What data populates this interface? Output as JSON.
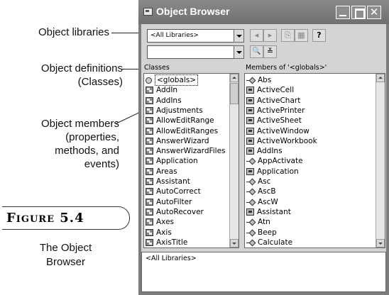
{
  "callouts": {
    "libraries": "Object libraries",
    "definitions_line1": "Object definitions",
    "definitions_line2": "(Classes)",
    "members_line1": "Object members",
    "members_line2": "(properties,",
    "members_line3": "methods, and",
    "members_line4": "events)"
  },
  "figure": {
    "label": "Figure 5.4",
    "caption_line1": "The Object",
    "caption_line2": "Browser"
  },
  "window": {
    "title": "Object Browser",
    "close_glyph": "✕"
  },
  "toolbar": {
    "library_select": "<All Libraries>",
    "search_value": "",
    "back_icon": "◂",
    "forward_icon": "▸",
    "copy_icon": "⎘",
    "view_def_icon": "▦",
    "help_icon": "?",
    "search_icon": "🔍",
    "toggle_icon": "≚"
  },
  "classes": {
    "header": "Classes",
    "items": [
      {
        "name": "<globals>",
        "icon": "globe-icon",
        "selected": true
      },
      {
        "name": "AddIn",
        "icon": "class-icon"
      },
      {
        "name": "AddIns",
        "icon": "class-icon"
      },
      {
        "name": "Adjustments",
        "icon": "class-icon"
      },
      {
        "name": "AllowEditRange",
        "icon": "class-icon"
      },
      {
        "name": "AllowEditRanges",
        "icon": "class-icon"
      },
      {
        "name": "AnswerWizard",
        "icon": "class-icon"
      },
      {
        "name": "AnswerWizardFiles",
        "icon": "class-icon"
      },
      {
        "name": "Application",
        "icon": "class-icon"
      },
      {
        "name": "Areas",
        "icon": "class-icon"
      },
      {
        "name": "Assistant",
        "icon": "class-icon"
      },
      {
        "name": "AutoCorrect",
        "icon": "class-icon"
      },
      {
        "name": "AutoFilter",
        "icon": "class-icon"
      },
      {
        "name": "AutoRecover",
        "icon": "class-icon"
      },
      {
        "name": "Axes",
        "icon": "class-icon"
      },
      {
        "name": "Axis",
        "icon": "class-icon"
      },
      {
        "name": "AxisTitle",
        "icon": "class-icon"
      }
    ]
  },
  "members": {
    "header": "Members of '<globals>'",
    "items": [
      {
        "name": "Abs",
        "icon": "method-icon"
      },
      {
        "name": "ActiveCell",
        "icon": "property-icon"
      },
      {
        "name": "ActiveChart",
        "icon": "property-icon"
      },
      {
        "name": "ActivePrinter",
        "icon": "property-icon"
      },
      {
        "name": "ActiveSheet",
        "icon": "property-icon"
      },
      {
        "name": "ActiveWindow",
        "icon": "property-icon"
      },
      {
        "name": "ActiveWorkbook",
        "icon": "property-icon"
      },
      {
        "name": "AddIns",
        "icon": "property-icon"
      },
      {
        "name": "AppActivate",
        "icon": "method-icon"
      },
      {
        "name": "Application",
        "icon": "property-icon"
      },
      {
        "name": "Asc",
        "icon": "method-icon"
      },
      {
        "name": "AscB",
        "icon": "method-icon"
      },
      {
        "name": "AscW",
        "icon": "method-icon"
      },
      {
        "name": "Assistant",
        "icon": "property-icon"
      },
      {
        "name": "Atn",
        "icon": "method-icon"
      },
      {
        "name": "Beep",
        "icon": "method-icon"
      },
      {
        "name": "Calculate",
        "icon": "method-icon"
      }
    ]
  },
  "details": {
    "text": "<All Libraries>"
  }
}
